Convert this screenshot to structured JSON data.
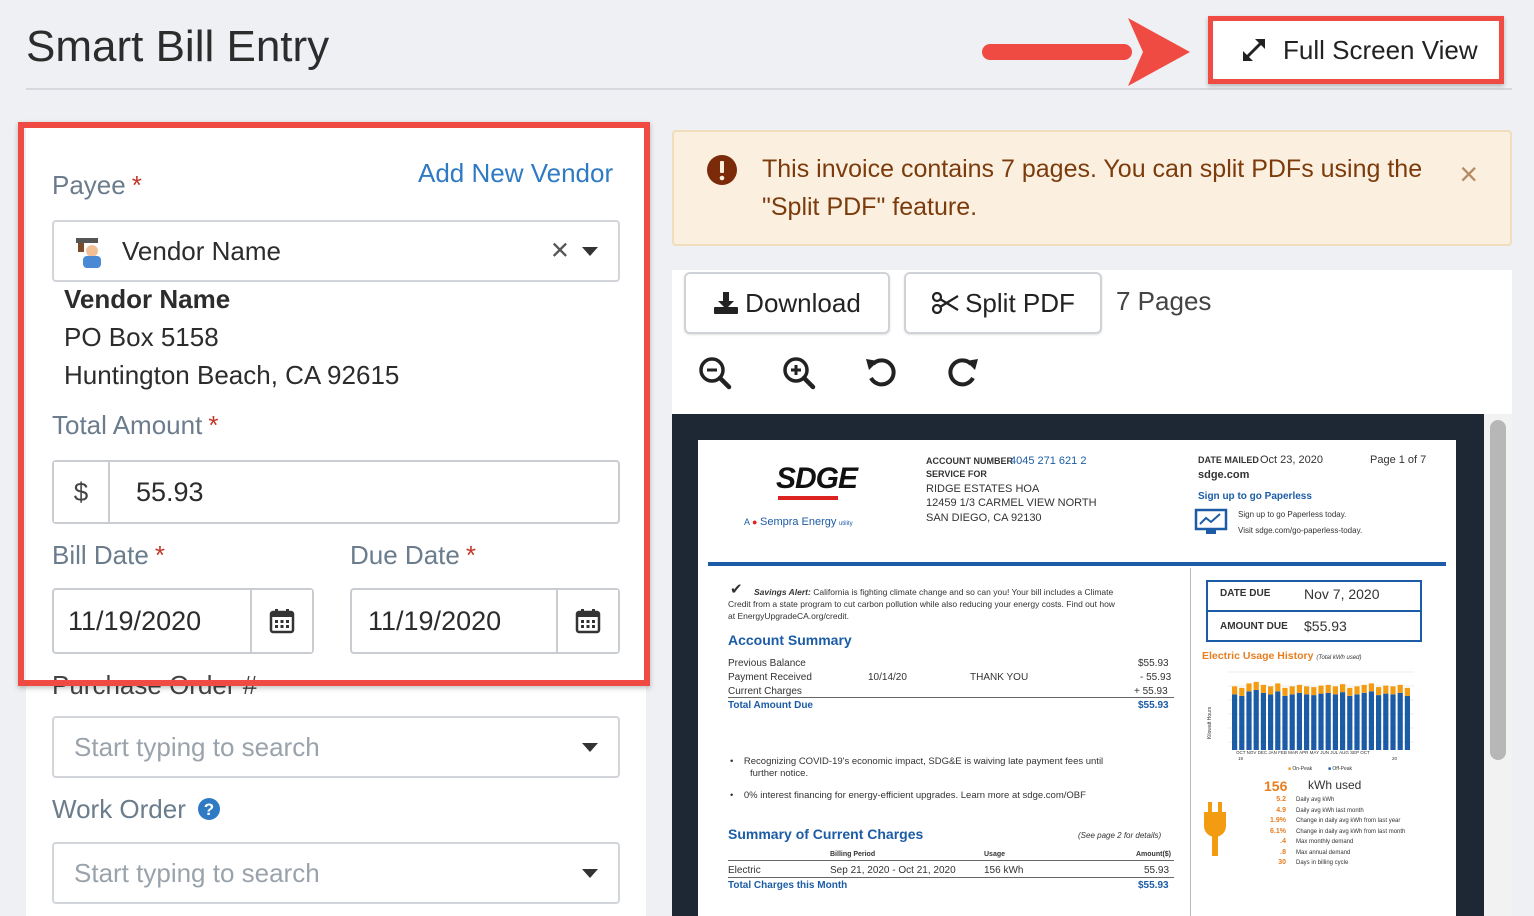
{
  "header": {
    "title": "Smart Bill Entry",
    "full_screen_label": "Full Screen View"
  },
  "form": {
    "payee_label": "Payee",
    "required_mark": "*",
    "add_vendor_label": "Add New Vendor",
    "payee_selected": "Vendor Name",
    "vendor_name": "Vendor Name",
    "vendor_address1": "PO Box 5158",
    "vendor_address2": "Huntington Beach, CA 92615",
    "total_amount_label": "Total Amount",
    "currency_symbol": "$",
    "total_amount_value": "55.93",
    "bill_date_label": "Bill Date",
    "bill_date_value": "11/19/2020",
    "due_date_label": "Due Date",
    "due_date_value": "11/19/2020",
    "purchase_order_label": "Purchase Order #",
    "purchase_order_placeholder": "Start typing to search",
    "work_order_label": "Work Order",
    "work_order_placeholder": "Start typing to search"
  },
  "alert": {
    "text": "This invoice contains 7 pages. You can split PDFs using the \"Split PDF\" feature.",
    "close": "×"
  },
  "viewer": {
    "download_label": "Download",
    "split_label": "Split PDF",
    "pages_label": "7 Pages"
  },
  "bill": {
    "logo": "SDGE",
    "logo_sub": "Sempra Energy",
    "logo_sub_prefix": "A",
    "logo_sub_suffix": "utility",
    "account_number_label": "ACCOUNT NUMBER",
    "account_number": "4045 271 621 2",
    "service_for_label": "SERVICE FOR",
    "service_name": "RIDGE ESTATES HOA",
    "service_addr1": "12459 1/3 CARMEL VIEW NORTH",
    "service_addr2": "SAN DIEGO, CA  92130",
    "date_mailed_label": "DATE MAILED",
    "date_mailed": "Oct 23, 2020",
    "page_of": "Page 1 of 7",
    "website": "sdge.com",
    "paperless_head": "Sign up to go Paperless",
    "paperless_line1": "Sign up to go Paperless today.",
    "paperless_line2": "Visit sdge.com/go-paperless-today.",
    "savings_alert": "Savings Alert:",
    "savings_text1": "California is fighting climate change and so can you! Your bill includes a Climate",
    "savings_text2": "Credit from a state program to cut carbon pollution while also reducing your energy costs. Find out how",
    "savings_text3": "at EnergyUpgradeCA.org/credit.",
    "account_summary": "Account Summary",
    "prev_balance_label": "Previous Balance",
    "prev_balance": "$55.93",
    "payment_label": "Payment Received",
    "payment_date": "10/14/20",
    "payment_note": "THANK YOU",
    "payment_amount": "- 55.93",
    "current_label": "Current Charges",
    "current_amount": "+ 55.93",
    "total_due_label": "Total Amount Due",
    "total_due": "$55.93",
    "date_due_label": "DATE DUE",
    "date_due": "Nov 7, 2020",
    "amount_due_label": "AMOUNT DUE",
    "amount_due": "$55.93",
    "usage_history": "Electric Usage History",
    "usage_history_sub": "(Total kWh used)",
    "usage_axis_label": "Kilowatt Hours",
    "chart_months": "OCT NOV DEC JAN FEB MAR APR MAY JUN JUL AUG SEP OCT",
    "chart_year_start": "19",
    "chart_year_end": "20",
    "legend_onpeak": "On-Peak",
    "legend_offpeak": "Off-Peak",
    "kwh_value": "156",
    "kwh_label": "kWh used",
    "stats": [
      {
        "v": "5.2",
        "l": "Daily avg kWh"
      },
      {
        "v": "4.9",
        "l": "Daily avg kWh last month"
      },
      {
        "v": "1.9%",
        "l": "Change in daily avg kWh from last year"
      },
      {
        "v": "6.1%",
        "l": "Change in daily avg kWh from last month"
      },
      {
        "v": ".4",
        "l": "Max monthly demand"
      },
      {
        "v": ".8",
        "l": "Max annual demand"
      },
      {
        "v": "30",
        "l": "Days in billing cycle"
      }
    ],
    "bullet1a": "Recognizing COVID-19's economic impact, SDG&E is waiving late payment fees until",
    "bullet1b": "further notice.",
    "bullet2": "0% interest financing for energy-efficient upgrades. Learn more at sdge.com/OBF",
    "summary_charges": "Summary of Current Charges",
    "see_page": "(See page 2 for details)",
    "billing_period_label": "Billing Period",
    "usage_label": "Usage",
    "amount_label": "Amount($)",
    "electric_label": "Electric",
    "billing_period": "Sep 21, 2020 - Oct 21, 2020",
    "usage": "156 kWh",
    "electric_amount": "55.93",
    "total_charges_label": "Total Charges this Month",
    "total_charges": "$55.93"
  },
  "colors": {
    "highlight": "#ef4b43",
    "link": "#2f7ac3",
    "alert_bg": "#fbf0df",
    "alert_text": "#7b3b0c"
  }
}
